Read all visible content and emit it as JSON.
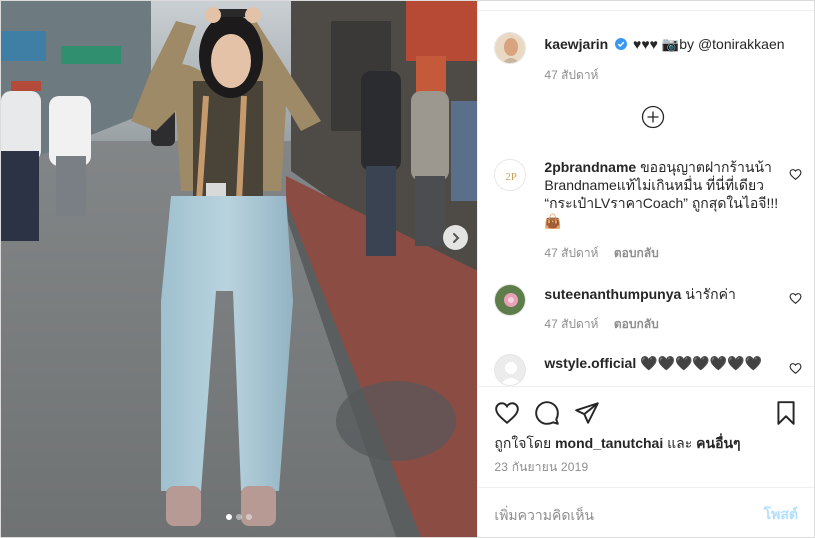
{
  "post": {
    "username": "kaewjarin",
    "caption": "♥♥♥ 📷by @tonirakkaen",
    "caption_time": "47 สัปดาห์",
    "verified": true
  },
  "comments": [
    {
      "username": "2pbrandname",
      "text": "ขออนุญาตฝากร้านน้า Brandnameแท้ไม่เกินหมื่น ที่นี่ที่เดียว “กระเป๋าLVราคาCoach” ถูกสุดในไอจี!!! 👜",
      "time": "47 สัปดาห์",
      "reply": "ตอบกลับ",
      "avatar_text": "2P"
    },
    {
      "username": "suteenanthumpunya",
      "text": "น่ารักค่า",
      "time": "47 สัปดาห์",
      "reply": "ตอบกลับ"
    },
    {
      "username": "wstyle.official",
      "text": "🖤🖤🖤🖤🖤🖤🖤"
    }
  ],
  "likes": {
    "prefix": "ถูกใจโดย",
    "user": "mond_tanutchai",
    "joiner": "และ",
    "others": "คนอื่นๆ"
  },
  "date": "23 กันยายน 2019",
  "comment_input": {
    "placeholder": "เพิ่มความคิดเห็น",
    "post_label": "โพสต์"
  },
  "carousel": {
    "count": 3,
    "active": 0
  },
  "colors": {
    "verified": "#3897f0",
    "post_button_disabled": "#b2dffc",
    "meta_gray": "#8e8e8e"
  }
}
